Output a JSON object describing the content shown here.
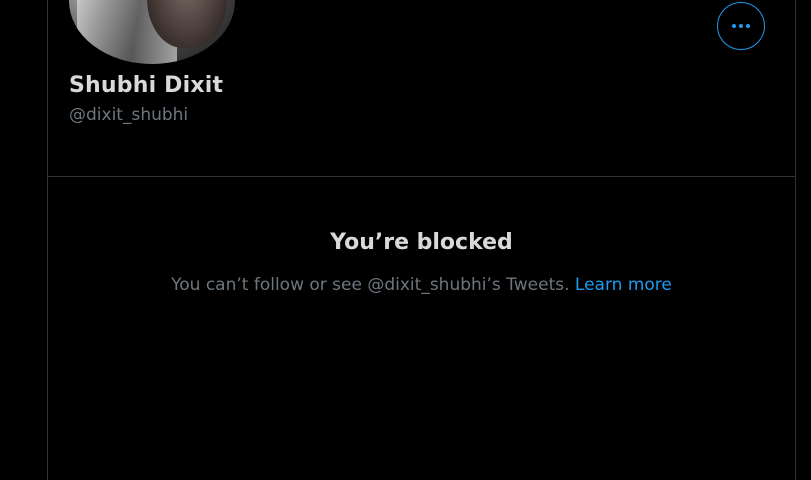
{
  "profile": {
    "name": "Shubhi Dixit",
    "handle": "@dixit_shubhi"
  },
  "blocked": {
    "title": "You’re blocked",
    "message": "You can’t follow or see @dixit_shubhi’s Tweets.",
    "learn_more": "Learn more"
  },
  "icons": {
    "more": "more-horizontal-icon"
  },
  "colors": {
    "background": "#000000",
    "accent": "#1d9bf0",
    "text_primary": "#d9d9d9",
    "text_secondary": "#6e767d",
    "border": "#2f3336"
  }
}
